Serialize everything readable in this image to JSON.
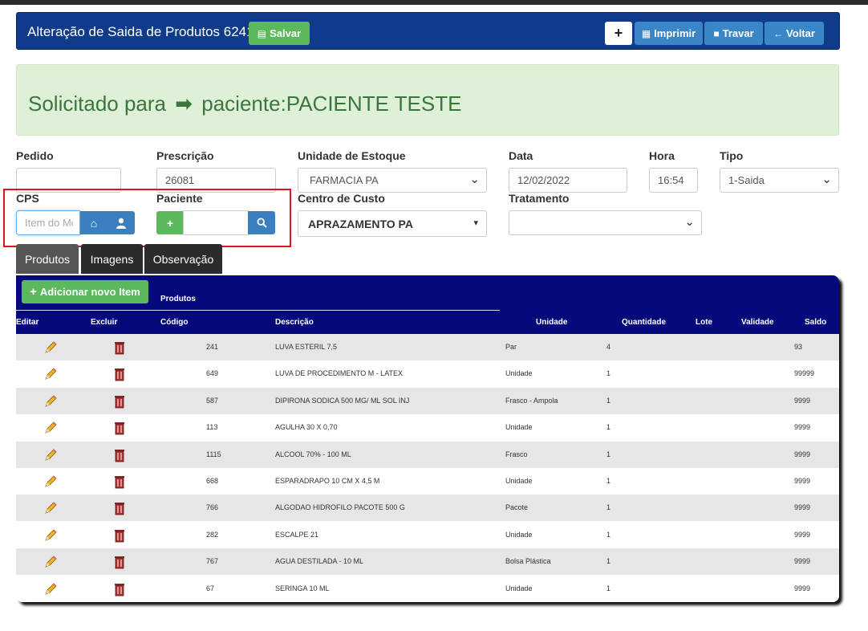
{
  "header": {
    "title": "Alteração de Saida de Produtos 6241",
    "save_label": "Salvar",
    "add_label": "+",
    "print_label": "Imprimir",
    "lock_label": "Travar",
    "back_label": "Voltar"
  },
  "alert": {
    "prefix": "Solicitado para",
    "text": "paciente:PACIENTE TESTE"
  },
  "form": {
    "pedido_label": "Pedido",
    "pedido_value": "",
    "prescricao_label": "Prescrição",
    "prescricao_value": "26081",
    "unidade_label": "Unidade de Estoque",
    "unidade_value": "FARMACIA PA",
    "data_label": "Data",
    "data_value": "12/02/2022",
    "hora_label": "Hora",
    "hora_value": "16:54",
    "tipo_label": "Tipo",
    "tipo_value": "1-Saida",
    "cps_label": "CPS",
    "cps_placeholder": "Item do Mo",
    "paciente_label": "Paciente",
    "paciente_value": "",
    "centro_label": "Centro de Custo",
    "centro_value": "APRAZAMENTO PA",
    "tratamento_label": "Tratamento",
    "tratamento_value": ""
  },
  "tabs": [
    "Produtos",
    "Imagens",
    "Observação"
  ],
  "table": {
    "add_item_label": "Adicionar novo Item",
    "section_title": "Produtos",
    "columns": {
      "editar": "Editar",
      "excluir": "Excluir",
      "codigo": "Código",
      "descricao": "Descrição",
      "unidade": "Unidade",
      "quantidade": "Quantidade",
      "lote": "Lote",
      "validade": "Validade",
      "saldo": "Saldo"
    },
    "rows": [
      {
        "codigo": "241",
        "descricao": "LUVA ESTERIL 7,5",
        "unidade": "Par",
        "quantidade": "4",
        "lote": "",
        "validade": "",
        "saldo": "93"
      },
      {
        "codigo": "649",
        "descricao": "LUVA DE PROCEDIMENTO M - LATEX",
        "unidade": "Unidade",
        "quantidade": "1",
        "lote": "",
        "validade": "",
        "saldo": "99999"
      },
      {
        "codigo": "587",
        "descricao": "DIPIRONA SODICA 500 MG/ ML SOL INJ",
        "unidade": "Frasco - Ampola",
        "quantidade": "1",
        "lote": "",
        "validade": "",
        "saldo": "9999"
      },
      {
        "codigo": "113",
        "descricao": "AGULHA 30 X 0,70",
        "unidade": "Unidade",
        "quantidade": "1",
        "lote": "",
        "validade": "",
        "saldo": "9999"
      },
      {
        "codigo": "1115",
        "descricao": "ALCOOL 70% - 100 ML",
        "unidade": "Frasco",
        "quantidade": "1",
        "lote": "",
        "validade": "",
        "saldo": "9999"
      },
      {
        "codigo": "668",
        "descricao": "ESPARADRAPO 10 CM X 4,5 M",
        "unidade": "Unidade",
        "quantidade": "1",
        "lote": "",
        "validade": "",
        "saldo": "9999"
      },
      {
        "codigo": "766",
        "descricao": "ALGODAO HIDROFILO PACOTE 500 G",
        "unidade": "Pacote",
        "quantidade": "1",
        "lote": "",
        "validade": "",
        "saldo": "9999"
      },
      {
        "codigo": "282",
        "descricao": "ESCALPE 21",
        "unidade": "Unidade",
        "quantidade": "1",
        "lote": "",
        "validade": "",
        "saldo": "9999"
      },
      {
        "codigo": "767",
        "descricao": "AGUA DESTILADA - 10 ML",
        "unidade": "Bolsa Plástica",
        "quantidade": "1",
        "lote": "",
        "validade": "",
        "saldo": "9999"
      },
      {
        "codigo": "67",
        "descricao": "SERINGA 10 ML",
        "unidade": "Unidade",
        "quantidade": "1",
        "lote": "",
        "validade": "",
        "saldo": "9999"
      }
    ]
  },
  "colors": {
    "header_bg": "#0f3b8a",
    "table_head_bg": "#06097a",
    "success": "#5cb85c",
    "primary": "#3b86c6",
    "alert_text": "#3c763d",
    "highlight_box": "#e0141e"
  }
}
